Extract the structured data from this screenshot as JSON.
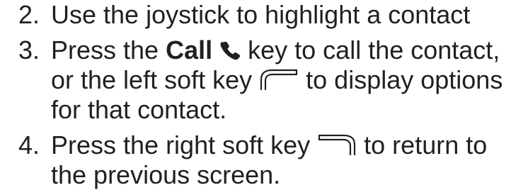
{
  "instructions": {
    "step2": {
      "number": "2.",
      "text": "Use the joystick to highlight a contact"
    },
    "step3": {
      "number": "3.",
      "text_before": "Press the ",
      "key_name": "Call",
      "icon_call": "phone-handset-icon",
      "text_middle": " key to call the contact, or the left soft key ",
      "icon_left": "left-soft-key-icon",
      "text_after": " to display options for that contact."
    },
    "step4": {
      "number": "4.",
      "text_before": "Press the right soft key ",
      "icon_right": "right-soft-key-icon",
      "text_after": " to return to the previous screen."
    }
  },
  "colors": {
    "text": "#231f20",
    "icon_stroke": "#231f20",
    "icon_fill": "#ffffff"
  }
}
